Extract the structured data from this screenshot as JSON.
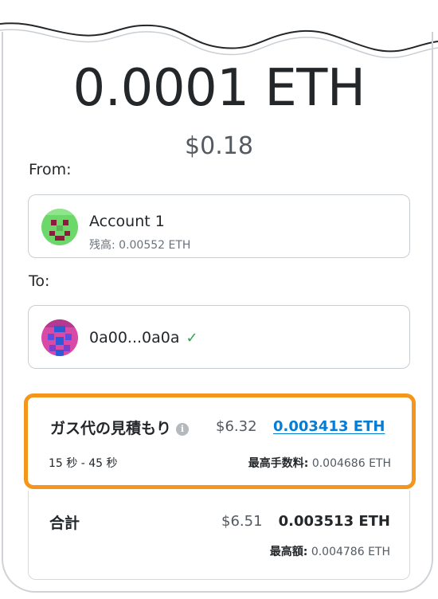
{
  "amount": {
    "crypto": "0.0001 ETH",
    "fiat": "$0.18"
  },
  "from": {
    "label": "From:",
    "account_name": "Account 1",
    "balance_label": "残高:",
    "balance_value": "0.00552 ETH",
    "avatar_icon": "green-identicon"
  },
  "to": {
    "label": "To:",
    "address": "0a00...0a0a",
    "check_icon": "checkmark-icon",
    "avatar_icon": "pink-blue-identicon"
  },
  "gas": {
    "title": "ガス代の見積もり",
    "info_icon": "i",
    "fiat": "$6.32",
    "eth": "0.003413 ETH",
    "time_estimate": "15 秒 - 45 秒",
    "max_fee_label": "最高手数料:",
    "max_fee_value": "0.004686 ETH",
    "highlight_color": "#f5961c"
  },
  "total": {
    "label": "合計",
    "fiat": "$6.51",
    "eth": "0.003513 ETH",
    "max_label": "最高額:",
    "max_value": "0.004786 ETH"
  },
  "colors": {
    "link": "#037dd6",
    "check": "#28a745"
  }
}
